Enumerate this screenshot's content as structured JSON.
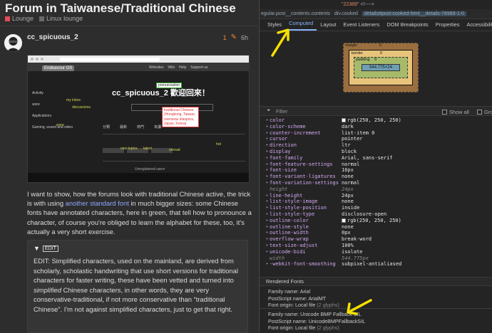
{
  "forum": {
    "title": "Forum in Taiwanese/Traditional Chinese",
    "categories": [
      {
        "name": "Lounge",
        "color": "#e44b5a"
      },
      {
        "name": "Linux lounge",
        "color": "#6a6a6a"
      }
    ],
    "post": {
      "username": "cc_spicuous_2",
      "edits": "1",
      "time": "6h",
      "embedded": {
        "logo": "Endeavour OS",
        "menu": [
          "Websites",
          "Wiki",
          "Help",
          "Support us"
        ],
        "heading": "cc_spicuous_2 歡迎回來！",
        "sidebar": [
          "Activity",
          "my inbox",
          "discussions",
          "wore",
          "Applications",
          "Gaming, sound and video"
        ],
        "annotation_pronunciation": "pronunciation",
        "annotation_box": "traditional Chinese (Hongkong, Taiwan, overseas diaspora, Japan, Korea)",
        "annotation_new": "new topics",
        "annotation_latest": "latest",
        "annotation_unread": "unread",
        "annotation_hot": "hot",
        "annotation_wore": "wore",
        "annotation_myinbox": "my inbox",
        "annotation_discussions": "discussions",
        "caption": "Unregistered users"
      },
      "body_before_link": "I want to show, how the forums look with traditional Chinese active, the trick is with using ",
      "link_text": "another standard font",
      "body_after_link": " in much bigger sizes: some Chinese fonts have annotated characters, here in green, that tell how to pronounce a character, of course you're obliged to learn the alphabet for these, too, it's actually a very short exercise.",
      "details_summary": "EDIT",
      "details_p1": "EDIT: Simplified characters, used on the mainland, are derived from scholarly, scholastic handwriting that use short versions for traditional characters for faster writing, these have been vetted and turned into ",
      "details_em": "simplified",
      "details_p2": " Chinese characters, in other words, they are very conservative-traditional, if not more conservative than “traditional Chinese”. I'm not against simplified characters, just to get that right."
    }
  },
  "devtools": {
    "top_value": "\"22389\"",
    "top_comment": "<!---->",
    "breadcrumbs": [
      "egular.post__contents.contents",
      "div.cooked",
      "details#post-cooked-html__details-78989-1-0"
    ],
    "tabs": [
      "Styles",
      "Computed",
      "Layout",
      "Event Listeners",
      "DOM Breakpoints",
      "Properties",
      "Accessibility"
    ],
    "active_tab": "Computed",
    "box_model": {
      "margin_label": "margin",
      "margin_value": "0",
      "border_label": "border",
      "border_value": "0",
      "padding_label": "padding",
      "padding_value": "0",
      "content": "544.775×24",
      "dash": "-"
    },
    "filter_placeholder": "Filter",
    "show_all": "Show all",
    "group": "Group",
    "properties": [
      {
        "name": "color",
        "value": "rgb(250, 250, 250)",
        "swatch": true
      },
      {
        "name": "color-scheme",
        "value": "dark"
      },
      {
        "name": "counter-increment",
        "value": "list-item 0"
      },
      {
        "name": "cursor",
        "value": "pointer"
      },
      {
        "name": "direction",
        "value": "ltr"
      },
      {
        "name": "display",
        "value": "block"
      },
      {
        "name": "font-family",
        "value": "Arial, sans-serif"
      },
      {
        "name": "font-feature-settings",
        "value": "normal"
      },
      {
        "name": "font-size",
        "value": "16px"
      },
      {
        "name": "font-variant-ligatures",
        "value": "none"
      },
      {
        "name": "font-variation-settings",
        "value": "normal"
      },
      {
        "name": "height",
        "value": "24px",
        "sub": true
      },
      {
        "name": "line-height",
        "value": "24px"
      },
      {
        "name": "list-style-image",
        "value": "none"
      },
      {
        "name": "list-style-position",
        "value": "inside"
      },
      {
        "name": "list-style-type",
        "value": "disclosure-open"
      },
      {
        "name": "outline-color",
        "value": "rgb(250, 250, 250)",
        "swatch": true
      },
      {
        "name": "outline-style",
        "value": "none"
      },
      {
        "name": "outline-width",
        "value": "0px"
      },
      {
        "name": "overflow-wrap",
        "value": "break-word"
      },
      {
        "name": "text-size-adjust",
        "value": "100%"
      },
      {
        "name": "unicode-bidi",
        "value": "isolate"
      },
      {
        "name": "width",
        "value": "544.775px",
        "sub": true
      },
      {
        "name": "-webkit-font-smoothing",
        "value": "subpixel-antialiased"
      }
    ],
    "rendered_fonts_header": "Rendered Fonts",
    "fonts": [
      {
        "family": "Family name: Arial",
        "postscript": "PostScript name: ArialMT",
        "origin": "Font origin: Local file",
        "glyphs": "(2 glyphs)"
      },
      {
        "family": "Family name: Unicode BMP Fallback SIL",
        "postscript": "PostScript name: UnicodeBMPFallbackSIL",
        "origin": "Font origin: Local file",
        "glyphs": "(2 glyphs)"
      }
    ],
    "arrow_color": "#f5e000"
  }
}
